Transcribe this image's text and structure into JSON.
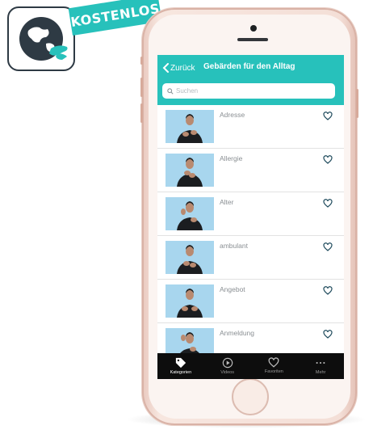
{
  "badge": {
    "text": "KOSTENLOS",
    "color": "#27c1bb"
  },
  "app_icon": {
    "name": "globe-hand-icon"
  },
  "nav": {
    "back_label": "Zurück",
    "title": "Gebärden für den Alltag",
    "color": "#27c1bb"
  },
  "search": {
    "placeholder": "Suchen",
    "icon": "search-icon"
  },
  "list": {
    "items": [
      {
        "label": "Adresse",
        "icon": "heart-outline-icon"
      },
      {
        "label": "Allergie",
        "icon": "heart-outline-icon"
      },
      {
        "label": "Alter",
        "icon": "heart-outline-icon"
      },
      {
        "label": "ambulant",
        "icon": "heart-outline-icon"
      },
      {
        "label": "Angebot",
        "icon": "heart-outline-icon"
      },
      {
        "label": "Anmeldung",
        "icon": "heart-outline-icon"
      }
    ]
  },
  "tabs": [
    {
      "label": "Kategorien",
      "icon": "tag-icon",
      "active": true
    },
    {
      "label": "Videos",
      "icon": "play-circle-icon",
      "active": false
    },
    {
      "label": "Favoriten",
      "icon": "heart-icon",
      "active": false
    },
    {
      "label": "Mehr",
      "icon": "more-dots-icon",
      "active": false
    }
  ]
}
